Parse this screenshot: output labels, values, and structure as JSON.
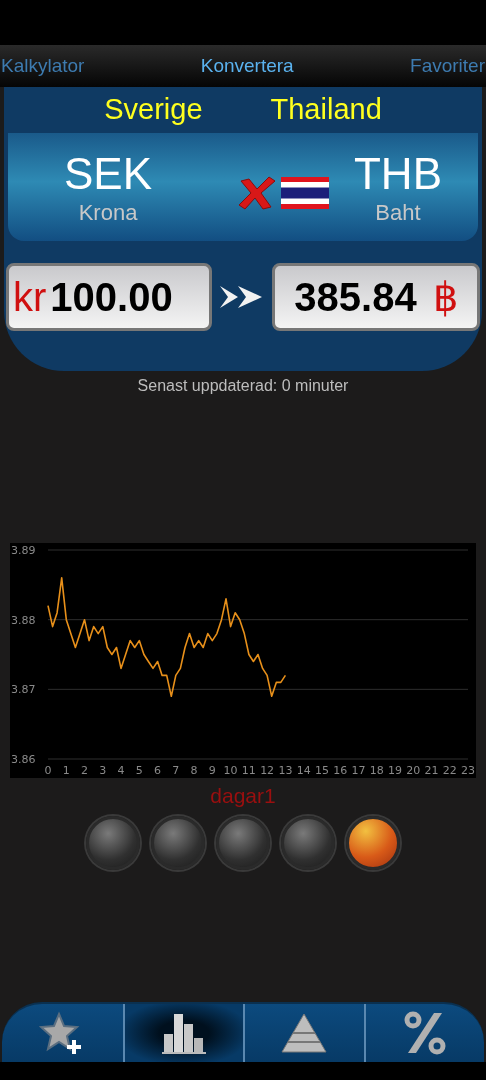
{
  "tabs": [
    {
      "label": "Kalkylator",
      "selected": false
    },
    {
      "label": "Konvertera",
      "selected": true
    },
    {
      "label": "Favoriter",
      "selected": false
    }
  ],
  "from": {
    "country": "Sverige",
    "code": "SEK",
    "name": "Krona",
    "symbol": "kr",
    "amount": "100.00"
  },
  "to": {
    "country": "Thailand",
    "code": "THB",
    "name": "Baht",
    "symbol": "฿",
    "amount": "385.84"
  },
  "updated": "Senast uppdaterad: 0 minuter",
  "chart": {
    "chart_data": {
      "type": "line",
      "x": [
        0,
        0.25,
        0.5,
        0.75,
        1,
        1.25,
        1.5,
        1.75,
        2,
        2.25,
        2.5,
        2.75,
        3,
        3.25,
        3.5,
        3.75,
        4,
        4.25,
        4.5,
        4.75,
        5,
        5.25,
        5.5,
        5.75,
        6,
        6.25,
        6.5,
        6.75,
        7,
        7.25,
        7.5,
        7.75,
        8,
        8.25,
        8.5,
        8.75,
        9,
        9.25,
        9.5,
        9.75,
        10,
        10.25,
        10.5,
        10.75,
        11,
        11.25,
        11.5,
        11.75,
        12,
        12.25,
        12.5,
        12.75,
        13
      ],
      "series": [
        {
          "color": "#e8901a",
          "values": [
            3.882,
            3.879,
            3.881,
            3.886,
            3.88,
            3.878,
            3.876,
            3.878,
            3.88,
            3.877,
            3.879,
            3.878,
            3.879,
            3.876,
            3.875,
            3.876,
            3.873,
            3.875,
            3.877,
            3.876,
            3.877,
            3.875,
            3.874,
            3.873,
            3.874,
            3.872,
            3.872,
            3.869,
            3.872,
            3.873,
            3.876,
            3.878,
            3.876,
            3.877,
            3.876,
            3.878,
            3.877,
            3.878,
            3.88,
            3.883,
            3.879,
            3.881,
            3.88,
            3.878,
            3.875,
            3.874,
            3.875,
            3.873,
            3.872,
            3.869,
            3.871,
            3.871,
            3.872
          ]
        }
      ],
      "xlim": [
        0,
        23
      ],
      "ylim": [
        3.86,
        3.89
      ],
      "xticks": [
        0,
        1,
        2,
        3,
        4,
        5,
        6,
        7,
        8,
        9,
        10,
        11,
        12,
        13,
        14,
        15,
        16,
        17,
        18,
        19,
        20,
        21,
        22,
        23
      ],
      "yticks": [
        3.86,
        3.87,
        3.88,
        3.89
      ]
    }
  },
  "period_label": "dagar1",
  "period_dots": [
    {
      "selected": false
    },
    {
      "selected": false
    },
    {
      "selected": false
    },
    {
      "selected": false
    },
    {
      "selected": true
    }
  ],
  "nav": [
    {
      "kind": "favorite-add",
      "selected": false
    },
    {
      "kind": "chart",
      "selected": true
    },
    {
      "kind": "pyramid",
      "selected": false
    },
    {
      "kind": "percent",
      "selected": false
    }
  ]
}
